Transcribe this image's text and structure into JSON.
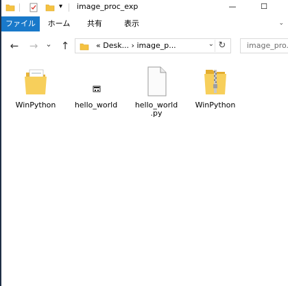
{
  "window": {
    "title": "image_proc_exp",
    "minimize_glyph": "—",
    "maximize_glyph": "☐"
  },
  "ribbon": {
    "tabs": [
      {
        "label": "ファイル"
      },
      {
        "label": "ホーム"
      },
      {
        "label": "共有"
      },
      {
        "label": "表示"
      }
    ],
    "accent": "#1979ca"
  },
  "navigation": {
    "back_glyph": "←",
    "forward_glyph": "→",
    "history_glyph": "⌄",
    "up_glyph": "↑",
    "address_path": "« Desk... › image_p...",
    "refresh_glyph": "↻",
    "search_placeholder": "image_pro..."
  },
  "files": [
    {
      "name": "WinPython",
      "icon": "folder-open-document-icon"
    },
    {
      "name": "hello_world",
      "icon": "executable-icon"
    },
    {
      "name": "hello_world",
      "name2": ".py",
      "icon": "blank-file-icon"
    },
    {
      "name": "WinPython",
      "icon": "zip-folder-icon"
    }
  ]
}
